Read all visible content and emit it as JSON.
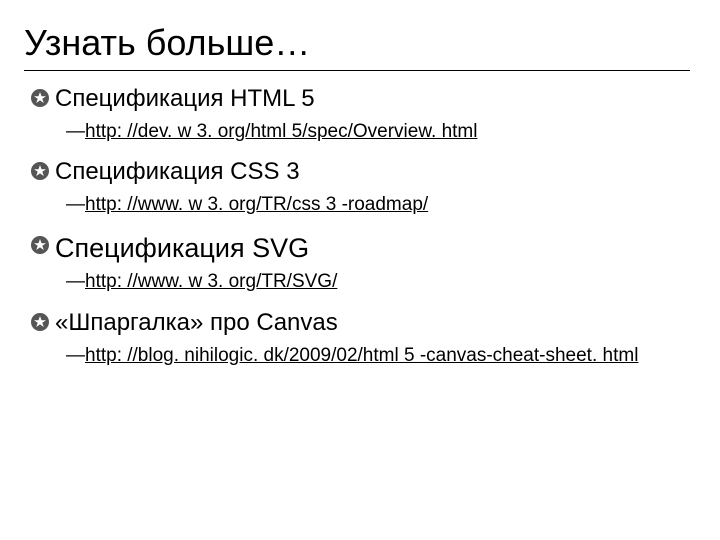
{
  "title": "Узнать больше…",
  "items": [
    {
      "label": "Спецификация HTML 5",
      "large": false,
      "link_underline": true,
      "link": "http: //dev. w 3. org/html 5/spec/Overview. html"
    },
    {
      "label": "Спецификация CSS 3",
      "large": false,
      "link_underline": true,
      "link": "http: //www. w 3. org/TR/css 3 -roadmap/"
    },
    {
      "label": "Спецификация SVG",
      "large": true,
      "link_underline": true,
      "link": "http: //www. w 3. org/TR/SVG/"
    },
    {
      "label": "«Шпаргалка» про Canvas",
      "large": false,
      "link_underline": true,
      "link": "http: //blog. nihilogic. dk/2009/02/html 5 -canvas-cheat-sheet. html"
    }
  ]
}
